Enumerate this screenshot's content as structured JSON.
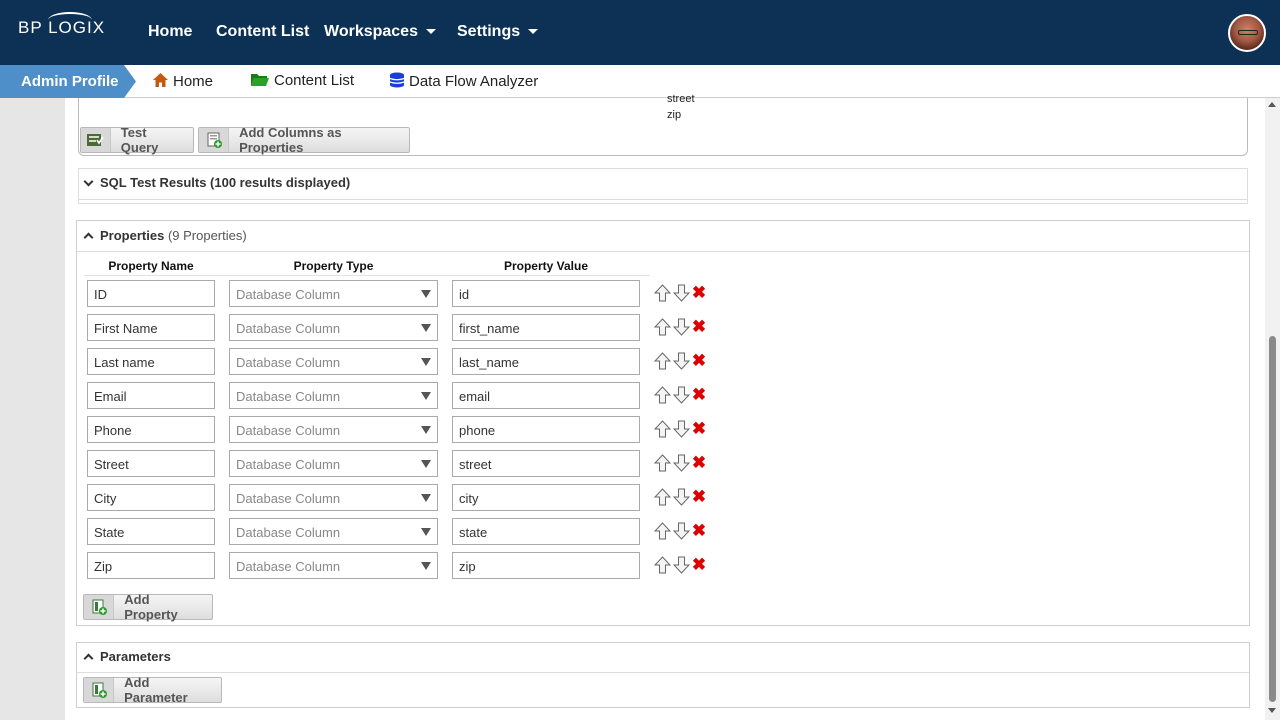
{
  "header": {
    "logo_text": "BP LOGIX",
    "nav": [
      {
        "label": "Home"
      },
      {
        "label": "Content List"
      },
      {
        "label": "Workspaces"
      },
      {
        "label": "Settings"
      }
    ]
  },
  "breadcrumb": {
    "current": "Admin Profile",
    "links": [
      {
        "label": "Home",
        "icon": "home-icon"
      },
      {
        "label": "Content List",
        "icon": "folder-icon"
      },
      {
        "label": "Data Flow Analyzer",
        "icon": "database-icon"
      }
    ]
  },
  "query": {
    "columns": [
      "street",
      "zip"
    ],
    "test_query_label": "Test Query",
    "add_columns_label": "Add Columns as Properties"
  },
  "sql_results": {
    "title": "SQL Test Results (100 results displayed)"
  },
  "properties": {
    "title": "Properties",
    "count_text": "(9 Properties)",
    "headers": {
      "name": "Property Name",
      "type": "Property Type",
      "value": "Property Value"
    },
    "rows": [
      {
        "name": "ID",
        "type": "Database Column",
        "value": "id"
      },
      {
        "name": "First Name",
        "type": "Database Column",
        "value": "first_name"
      },
      {
        "name": "Last name",
        "type": "Database Column",
        "value": "last_name"
      },
      {
        "name": "Email",
        "type": "Database Column",
        "value": "email"
      },
      {
        "name": "Phone",
        "type": "Database Column",
        "value": "phone"
      },
      {
        "name": "Street",
        "type": "Database Column",
        "value": "street"
      },
      {
        "name": "City",
        "type": "Database Column",
        "value": "city"
      },
      {
        "name": "State",
        "type": "Database Column",
        "value": "state"
      },
      {
        "name": "Zip",
        "type": "Database Column",
        "value": "zip"
      }
    ],
    "add_label": "Add Property"
  },
  "parameters": {
    "title": "Parameters",
    "add_label": "Add Parameter"
  },
  "colors": {
    "nav_bg": "#0d3154",
    "crumb_active": "#4f8fc9",
    "delete_red": "#dd0000"
  }
}
